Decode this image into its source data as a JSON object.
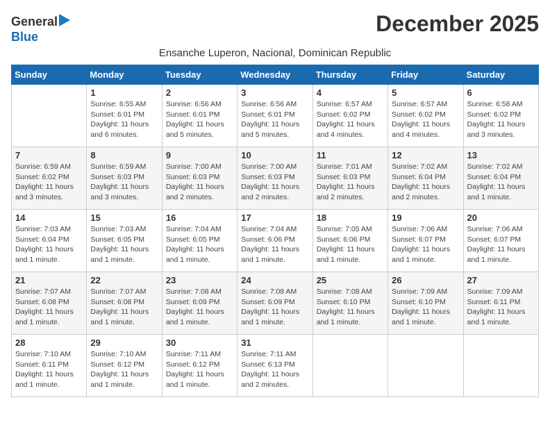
{
  "logo": {
    "general": "General",
    "blue": "Blue",
    "arrow": "▶"
  },
  "title": "December 2025",
  "subtitle": "Ensanche Luperon, Nacional, Dominican Republic",
  "days_of_week": [
    "Sunday",
    "Monday",
    "Tuesday",
    "Wednesday",
    "Thursday",
    "Friday",
    "Saturday"
  ],
  "weeks": [
    [
      {
        "num": "",
        "info": ""
      },
      {
        "num": "1",
        "info": "Sunrise: 6:55 AM\nSunset: 6:01 PM\nDaylight: 11 hours\nand 6 minutes."
      },
      {
        "num": "2",
        "info": "Sunrise: 6:56 AM\nSunset: 6:01 PM\nDaylight: 11 hours\nand 5 minutes."
      },
      {
        "num": "3",
        "info": "Sunrise: 6:56 AM\nSunset: 6:01 PM\nDaylight: 11 hours\nand 5 minutes."
      },
      {
        "num": "4",
        "info": "Sunrise: 6:57 AM\nSunset: 6:02 PM\nDaylight: 11 hours\nand 4 minutes."
      },
      {
        "num": "5",
        "info": "Sunrise: 6:57 AM\nSunset: 6:02 PM\nDaylight: 11 hours\nand 4 minutes."
      },
      {
        "num": "6",
        "info": "Sunrise: 6:58 AM\nSunset: 6:02 PM\nDaylight: 11 hours\nand 3 minutes."
      }
    ],
    [
      {
        "num": "7",
        "info": "Sunrise: 6:59 AM\nSunset: 6:02 PM\nDaylight: 11 hours\nand 3 minutes."
      },
      {
        "num": "8",
        "info": "Sunrise: 6:59 AM\nSunset: 6:03 PM\nDaylight: 11 hours\nand 3 minutes."
      },
      {
        "num": "9",
        "info": "Sunrise: 7:00 AM\nSunset: 6:03 PM\nDaylight: 11 hours\nand 2 minutes."
      },
      {
        "num": "10",
        "info": "Sunrise: 7:00 AM\nSunset: 6:03 PM\nDaylight: 11 hours\nand 2 minutes."
      },
      {
        "num": "11",
        "info": "Sunrise: 7:01 AM\nSunset: 6:03 PM\nDaylight: 11 hours\nand 2 minutes."
      },
      {
        "num": "12",
        "info": "Sunrise: 7:02 AM\nSunset: 6:04 PM\nDaylight: 11 hours\nand 2 minutes."
      },
      {
        "num": "13",
        "info": "Sunrise: 7:02 AM\nSunset: 6:04 PM\nDaylight: 11 hours\nand 1 minute."
      }
    ],
    [
      {
        "num": "14",
        "info": "Sunrise: 7:03 AM\nSunset: 6:04 PM\nDaylight: 11 hours\nand 1 minute."
      },
      {
        "num": "15",
        "info": "Sunrise: 7:03 AM\nSunset: 6:05 PM\nDaylight: 11 hours\nand 1 minute."
      },
      {
        "num": "16",
        "info": "Sunrise: 7:04 AM\nSunset: 6:05 PM\nDaylight: 11 hours\nand 1 minute."
      },
      {
        "num": "17",
        "info": "Sunrise: 7:04 AM\nSunset: 6:06 PM\nDaylight: 11 hours\nand 1 minute."
      },
      {
        "num": "18",
        "info": "Sunrise: 7:05 AM\nSunset: 6:06 PM\nDaylight: 11 hours\nand 1 minute."
      },
      {
        "num": "19",
        "info": "Sunrise: 7:06 AM\nSunset: 6:07 PM\nDaylight: 11 hours\nand 1 minute."
      },
      {
        "num": "20",
        "info": "Sunrise: 7:06 AM\nSunset: 6:07 PM\nDaylight: 11 hours\nand 1 minute."
      }
    ],
    [
      {
        "num": "21",
        "info": "Sunrise: 7:07 AM\nSunset: 6:08 PM\nDaylight: 11 hours\nand 1 minute."
      },
      {
        "num": "22",
        "info": "Sunrise: 7:07 AM\nSunset: 6:08 PM\nDaylight: 11 hours\nand 1 minute."
      },
      {
        "num": "23",
        "info": "Sunrise: 7:08 AM\nSunset: 6:09 PM\nDaylight: 11 hours\nand 1 minute."
      },
      {
        "num": "24",
        "info": "Sunrise: 7:08 AM\nSunset: 6:09 PM\nDaylight: 11 hours\nand 1 minute."
      },
      {
        "num": "25",
        "info": "Sunrise: 7:08 AM\nSunset: 6:10 PM\nDaylight: 11 hours\nand 1 minute."
      },
      {
        "num": "26",
        "info": "Sunrise: 7:09 AM\nSunset: 6:10 PM\nDaylight: 11 hours\nand 1 minute."
      },
      {
        "num": "27",
        "info": "Sunrise: 7:09 AM\nSunset: 6:11 PM\nDaylight: 11 hours\nand 1 minute."
      }
    ],
    [
      {
        "num": "28",
        "info": "Sunrise: 7:10 AM\nSunset: 6:11 PM\nDaylight: 11 hours\nand 1 minute."
      },
      {
        "num": "29",
        "info": "Sunrise: 7:10 AM\nSunset: 6:12 PM\nDaylight: 11 hours\nand 1 minute."
      },
      {
        "num": "30",
        "info": "Sunrise: 7:11 AM\nSunset: 6:12 PM\nDaylight: 11 hours\nand 1 minute."
      },
      {
        "num": "31",
        "info": "Sunrise: 7:11 AM\nSunset: 6:13 PM\nDaylight: 11 hours\nand 2 minutes."
      },
      {
        "num": "",
        "info": ""
      },
      {
        "num": "",
        "info": ""
      },
      {
        "num": "",
        "info": ""
      }
    ]
  ]
}
